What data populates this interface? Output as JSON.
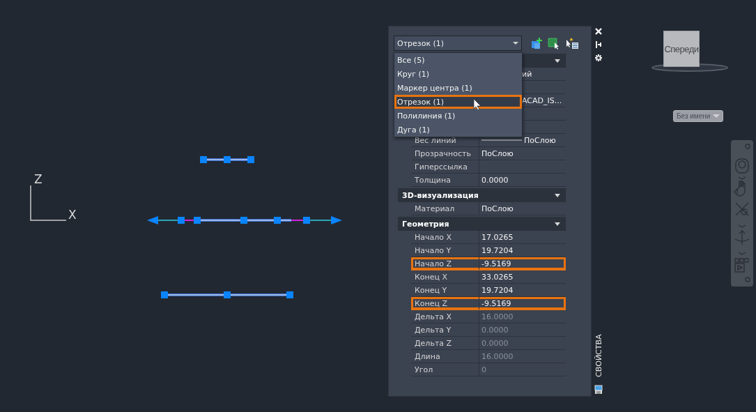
{
  "drawing": {
    "axis_labels": [
      "Z",
      "X"
    ]
  },
  "properties_palette": {
    "object_select": {
      "value": "Отрезок (1)",
      "expanded": true,
      "options": [
        {
          "label": "Все (5)",
          "selected": false
        },
        {
          "label": "Круг (1)",
          "selected": false
        },
        {
          "label": "Маркер центра (1)",
          "selected": false
        },
        {
          "label": "Отрезок (1)",
          "selected": true
        },
        {
          "label": "Полилиния (1)",
          "selected": false
        },
        {
          "label": "Дуга (1)",
          "selected": false
        }
      ]
    },
    "sections": [
      {
        "expanded": true,
        "rows": [
          {
            "kind": "covered",
            "value": "ий"
          },
          {
            "kind": "covered"
          },
          {
            "kind": "covered",
            "value": "ACAD_IS..."
          },
          {
            "kind": "covered"
          },
          {
            "kind": "covered"
          },
          {
            "kind": "lineweight",
            "label": "Вес линий",
            "value": "ПоСлою",
            "disabled": false,
            "highlighted": false
          },
          {
            "kind": "text",
            "label": "Прозрачность",
            "value": "ПоСлою",
            "disabled": false,
            "highlighted": false
          },
          {
            "kind": "text",
            "label": "Гиперссылка",
            "highlighted": false
          },
          {
            "kind": "text",
            "label": "Толщина",
            "value": "0.0000",
            "disabled": false,
            "highlighted": false
          }
        ]
      },
      {
        "title": "3D-визуализация",
        "expanded": true,
        "rows": [
          {
            "kind": "text",
            "label": "Материал",
            "value": "ПоСлою",
            "disabled": false,
            "highlighted": false
          }
        ]
      },
      {
        "title": "Геометрия",
        "expanded": true,
        "rows": [
          {
            "kind": "text",
            "label": "Начало X",
            "value": "17.0265",
            "disabled": false,
            "highlighted": false
          },
          {
            "kind": "text",
            "label": "Начало Y",
            "value": "19.7204",
            "disabled": false,
            "highlighted": false
          },
          {
            "kind": "text",
            "label": "Начало Z",
            "value": "-9.5169",
            "disabled": false,
            "highlighted": true
          },
          {
            "kind": "text",
            "label": "Конец X",
            "value": "33.0265",
            "disabled": false,
            "highlighted": false
          },
          {
            "kind": "text",
            "label": "Конец Y",
            "value": "19.7204",
            "disabled": false,
            "highlighted": false
          },
          {
            "kind": "text",
            "label": "Конец Z",
            "value": "-9.5169",
            "disabled": false,
            "highlighted": true
          },
          {
            "kind": "text",
            "label": "Дельта X",
            "value": "16.0000",
            "disabled": true,
            "highlighted": false
          },
          {
            "kind": "text",
            "label": "Дельта Y",
            "value": "0.0000",
            "disabled": true,
            "highlighted": false
          },
          {
            "kind": "text",
            "label": "Дельта Z",
            "value": "0.0000",
            "disabled": true,
            "highlighted": false
          },
          {
            "kind": "text",
            "label": "Длина",
            "value": "16.0000",
            "disabled": true,
            "highlighted": false
          },
          {
            "kind": "text",
            "label": "Угол",
            "value": "0",
            "disabled": true,
            "highlighted": false
          }
        ]
      }
    ],
    "side_title": "СВОЙСТВА"
  },
  "view_cube": {
    "face": "Спереди"
  },
  "view_name": {
    "value": "Без имени"
  }
}
